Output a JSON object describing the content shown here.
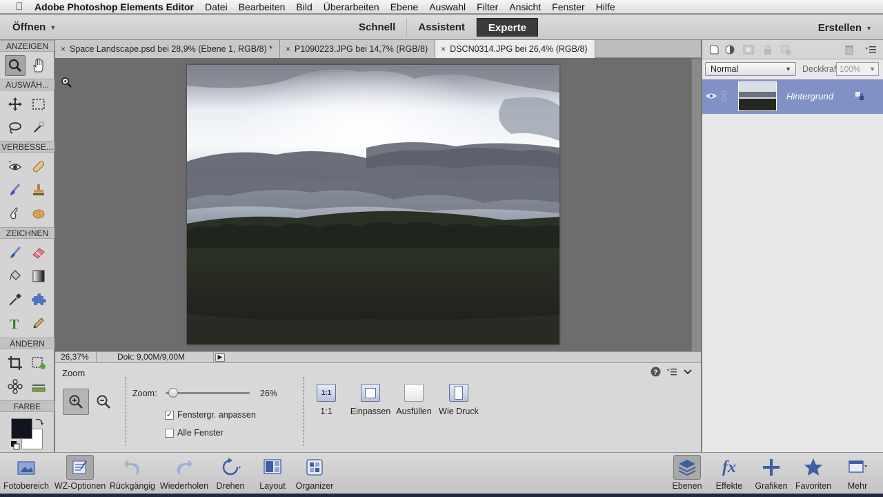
{
  "menubar": {
    "app": "Adobe Photoshop Elements Editor",
    "items": [
      "Datei",
      "Bearbeiten",
      "Bild",
      "Überarbeiten",
      "Ebene",
      "Auswahl",
      "Filter",
      "Ansicht",
      "Fenster",
      "Hilfe"
    ]
  },
  "modebar": {
    "open": "Öffnen",
    "modes": [
      "Schnell",
      "Assistent",
      "Experte"
    ],
    "active_mode": "Experte",
    "create": "Erstellen"
  },
  "toolbox": {
    "sections": [
      "ANZEIGEN",
      "AUSWÄH...",
      "VERBESSE...",
      "ZEICHNEN",
      "ÄNDERN",
      "FARBE"
    ]
  },
  "tabs": [
    "Space Landscape.psd bei 28,9% (Ebene 1, RGB/8) *",
    "P1090223.JPG bei 14,7% (RGB/8)",
    "DSCN0314.JPG bei 26,4% (RGB/8)"
  ],
  "status": {
    "zoom": "26,37%",
    "doc": "Dok: 9,00M/9,00M"
  },
  "options": {
    "title": "Zoom",
    "zoom_label": "Zoom:",
    "zoom_value": "26%",
    "zoom_slider_fraction": 0.05,
    "fit_window": "Fenstergr. anpassen",
    "fit_window_checked": true,
    "all_windows": "Alle Fenster",
    "all_windows_checked": false,
    "view_buttons": [
      "1:1",
      "Einpassen",
      "Ausfüllen",
      "Wie Druck"
    ],
    "one_to_one_icon": "1:1"
  },
  "layers": {
    "blend_mode": "Normal",
    "opacity_label": "Deckkraft:",
    "opacity_value": "100%",
    "layer_name": "Hintergrund"
  },
  "taskbar": {
    "left": [
      "Fotobereich",
      "WZ-Optionen",
      "Rückgängig",
      "Wiederholen",
      "Drehen",
      "Layout",
      "Organizer"
    ],
    "right": [
      "Ebenen",
      "Effekte",
      "Grafiken",
      "Favoriten",
      "Mehr"
    ],
    "effects_glyph": "fx"
  },
  "colors": {
    "accent_selected_layer": "#8291c5",
    "foreground_swatch": "#111520",
    "background_swatch": "#ffffff"
  }
}
